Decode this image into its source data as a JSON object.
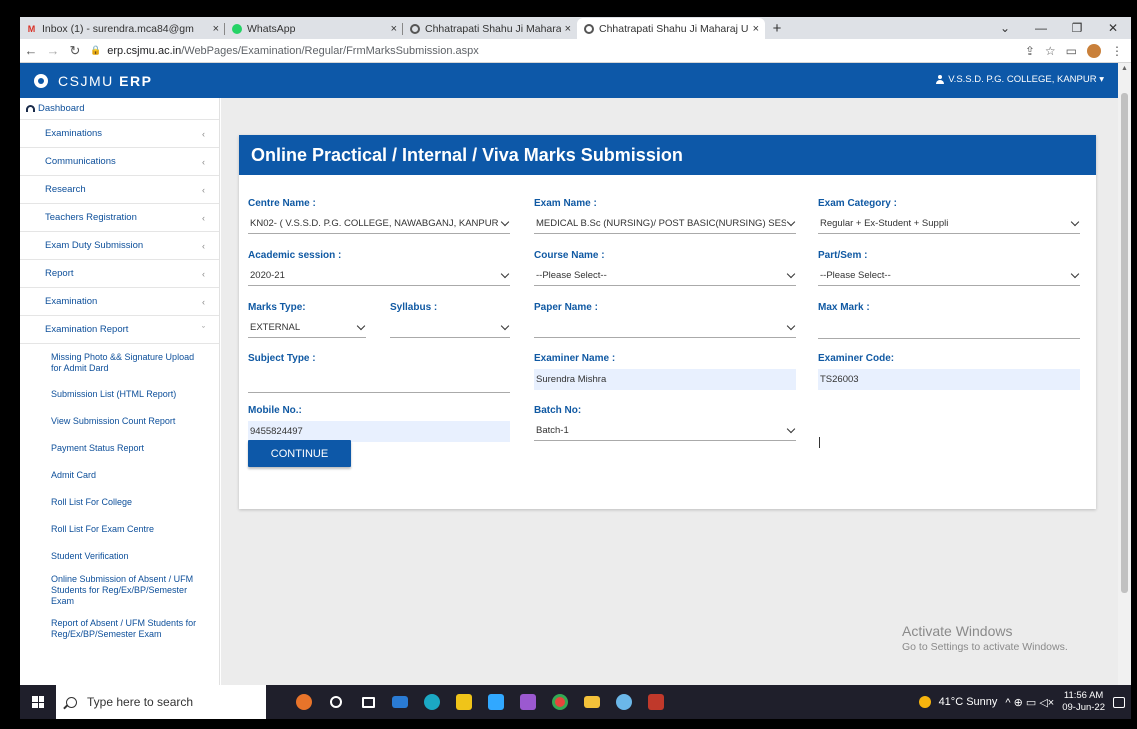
{
  "browser": {
    "tabs": [
      {
        "label": "Inbox (1) - surendra.mca84@gm",
        "icon": "gmail-icon",
        "close": "×"
      },
      {
        "label": "WhatsApp",
        "icon": "whatsapp-icon",
        "close": "×"
      },
      {
        "label": "Chhatrapati Shahu Ji Maharaj Un",
        "icon": "university-icon",
        "close": "×"
      },
      {
        "label": "Chhatrapati Shahu Ji Maharaj Un",
        "icon": "university-icon",
        "close": "×"
      }
    ],
    "new_tab": "+",
    "url_domain": "erp.csjmu.ac.in",
    "url_path": "/WebPages/Examination/Regular/FrmMarksSubmission.aspx",
    "window_min": "—",
    "window_max": "❐",
    "window_close": "✕"
  },
  "app": {
    "brand_prefix": "CSJMU ",
    "brand_bold": "ERP",
    "user": "V.S.S.D. P.G. COLLEGE, KANPUR ▾"
  },
  "sidebar": {
    "dashboard": "Dashboard",
    "items": [
      {
        "label": "Examinations",
        "chev": "‹"
      },
      {
        "label": "Communications",
        "chev": "‹"
      },
      {
        "label": "Research",
        "chev": "‹"
      },
      {
        "label": "Teachers Registration",
        "chev": "‹"
      },
      {
        "label": "Exam Duty Submission",
        "chev": "‹"
      },
      {
        "label": "Report",
        "chev": "‹"
      },
      {
        "label": "Examination",
        "chev": "‹"
      },
      {
        "label": "Examination Report",
        "chev": "ˇ"
      }
    ],
    "subitems": [
      "Missing Photo && Signature Upload for Admit Dard",
      "Submission List (HTML Report)",
      "View Submission Count Report",
      "Payment Status Report",
      "Admit Card",
      "Roll List For College",
      "Roll List For Exam Centre",
      "Student Verification",
      "Online Submission of Absent / UFM Students for Reg/Ex/BP/Semester Exam",
      "Report of Absent / UFM Students for Reg/Ex/BP/Semester Exam"
    ]
  },
  "form": {
    "title": "Online Practical / Internal / Viva Marks Submission",
    "centre_name_label": "Centre Name :",
    "centre_name_value": "KN02- ( V.S.S.D. P.G. COLLEGE, NAWABGANJ, KANPUR )",
    "exam_name_label": "Exam Name :",
    "exam_name_value": "MEDICAL B.Sc (NURSING)/ POST BASIC(NURSING) SESSION",
    "exam_category_label": "Exam Category :",
    "exam_category_value": "Regular + Ex-Student + Suppli",
    "academic_session_label": "Academic session :",
    "academic_session_value": "2020-21",
    "course_name_label": "Course Name :",
    "course_name_value": "--Please Select--",
    "part_sem_label": "Part/Sem :",
    "part_sem_value": "--Please Select--",
    "marks_type_label": "Marks Type:",
    "marks_type_value": "EXTERNAL",
    "syllabus_label": "Syllabus :",
    "syllabus_value": "",
    "paper_name_label": "Paper Name :",
    "paper_name_value": "",
    "max_mark_label": "Max Mark :",
    "max_mark_value": "",
    "subject_type_label": "Subject Type :",
    "subject_type_value": "",
    "examiner_name_label": "Examiner Name :",
    "examiner_name_value": "Surendra Mishra",
    "examiner_code_label": "Examiner Code:",
    "examiner_code_value": "TS26003",
    "mobile_label": "Mobile No.:",
    "mobile_value": "9455824497",
    "batch_label": "Batch No:",
    "batch_value": "Batch-1",
    "continue_label": "CONTINUE"
  },
  "watermark": {
    "line1": "Activate Windows",
    "line2": "Go to Settings to activate Windows."
  },
  "taskbar": {
    "search_placeholder": "Type here to search",
    "weather": "41°C  Sunny",
    "tray_icons": "^  ⊕  ▭  ◁×",
    "time": "11:56 AM",
    "date": "09-Jun-22"
  },
  "colors": {
    "brand_blue": "#0d58a8",
    "link_blue": "#0d4f9a",
    "filled_input": "#e8f0fe"
  }
}
